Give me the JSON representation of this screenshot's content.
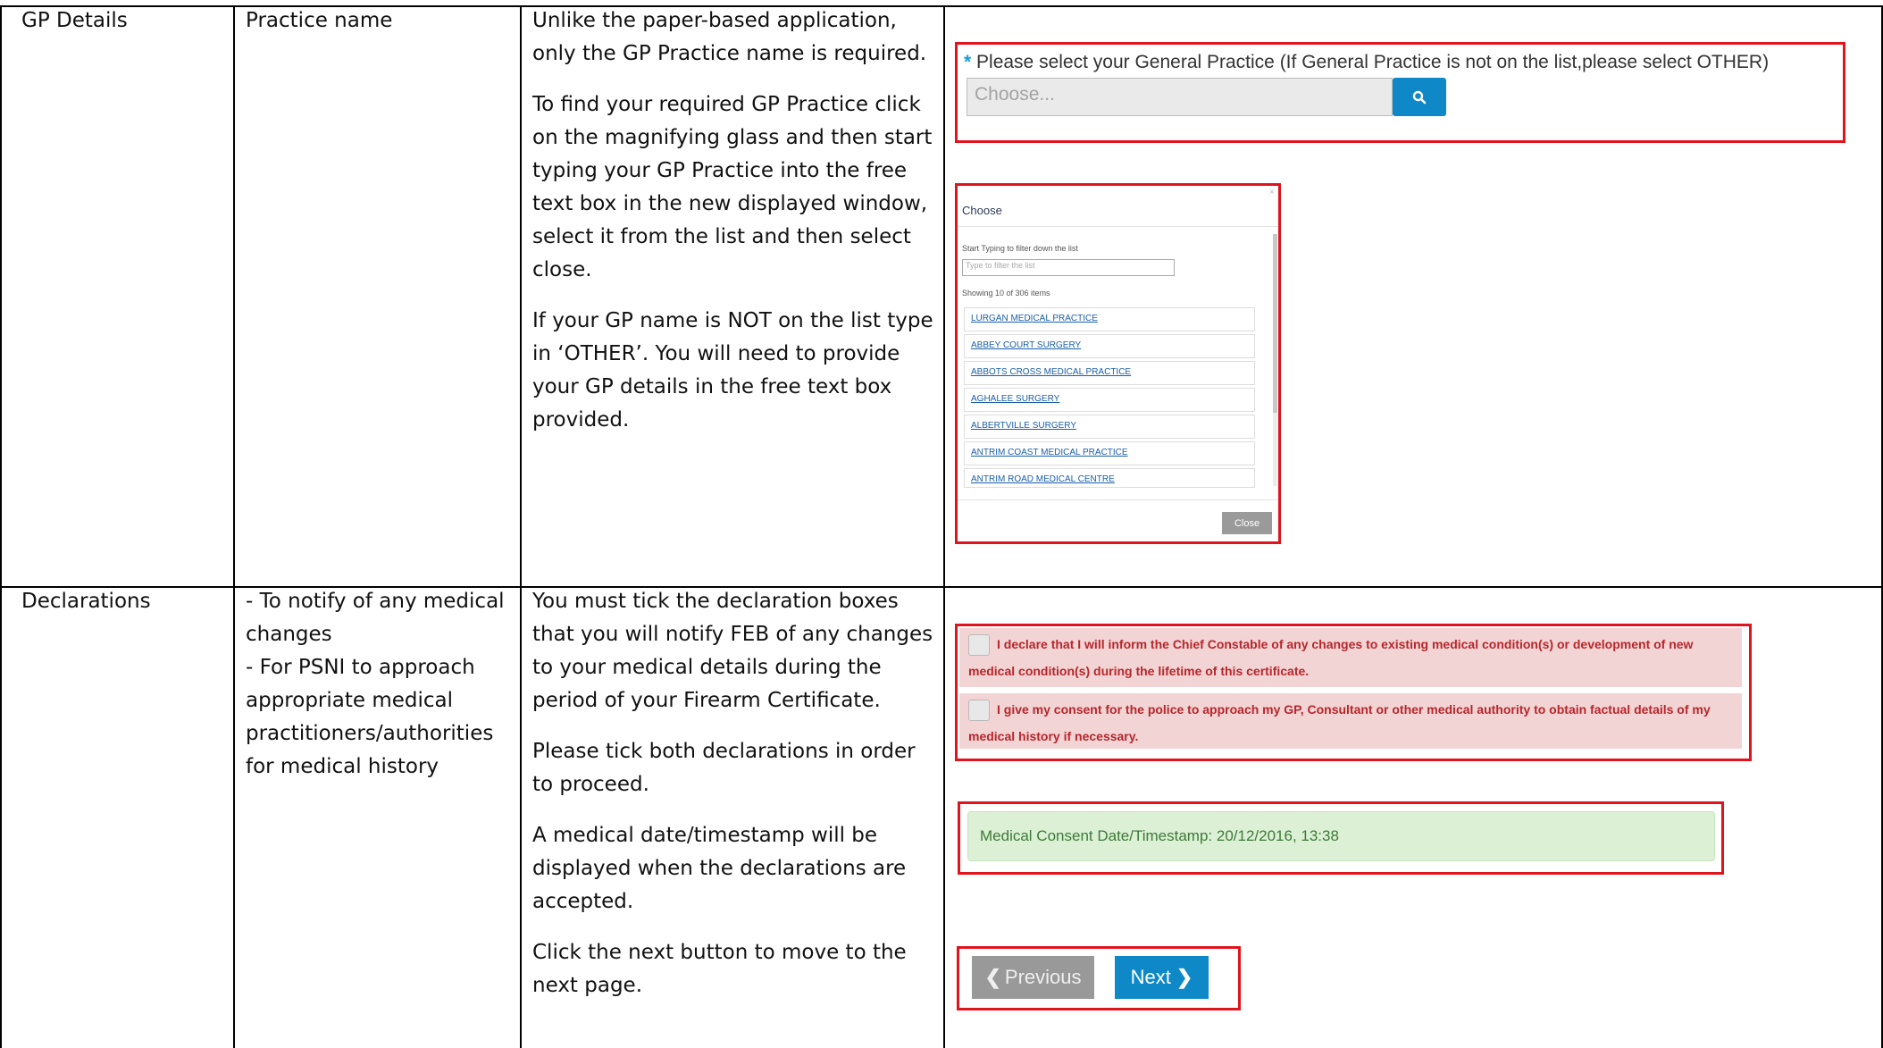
{
  "rows": [
    {
      "section": "GP Details",
      "field": "Practice name",
      "guidance": [
        "Unlike the paper-based application, only the GP Practice name is required.",
        "To find your required GP Practice click on the magnifying glass and then start typing your GP Practice into the free text box in the new displayed window, select it from the list and then select close.",
        "If your GP name is NOT on the list type in ‘OTHER’. You will need to provide your GP details in the free text box provided."
      ]
    },
    {
      "section": "Declarations",
      "field_lines": [
        "- To notify of any medical changes",
        "- For PSNI to approach appropriate medical practitioners/authorities for medical history"
      ],
      "guidance": [
        "You must tick the declaration boxes that you will notify FEB of any changes to your medical details during the period of your Firearm Certificate.",
        "Please tick both declarations in order to proceed.",
        "A medical date/timestamp will be displayed when the declarations are accepted.",
        "Click the next button to move to the next page."
      ]
    }
  ],
  "gp_select": {
    "required_marker": "*",
    "label": "Please select your General Practice (If General Practice is not on the list,please select OTHER)",
    "placeholder": "Choose...",
    "search_icon": "search-icon"
  },
  "modal": {
    "title": "Choose",
    "close_x": "×",
    "filter_label": "Start Typing to filter down the list",
    "filter_placeholder": "Type to filter the list",
    "count_text": "Showing 10 of 306 items",
    "items": [
      "LURGAN MEDICAL PRACTICE",
      "ABBEY COURT SURGERY",
      "ABBOTS CROSS MEDICAL PRACTICE",
      "AGHALEE SURGERY",
      "ALBERTVILLE SURGERY",
      "ANTRIM COAST MEDICAL PRACTICE",
      "ANTRIM ROAD MEDICAL CENTRE"
    ],
    "close_button": "Close"
  },
  "declarations": [
    "I declare that I will inform the Chief Constable of any changes to existing medical condition(s) or development of new medical condition(s) during the lifetime of this certificate.",
    "I give my consent for the police to approach my GP, Consultant or other medical authority to obtain factual details of my medical history if necessary."
  ],
  "consent_timestamp": "Medical Consent Date/Timestamp: 20/12/2016, 13:38",
  "nav": {
    "previous": "Previous",
    "next": "Next",
    "prev_icon": "chevron-left-icon",
    "next_icon": "chevron-right-icon"
  },
  "colors": {
    "highlight_border": "#e0141c",
    "primary": "#0e88c7",
    "declaration_bg": "#f2d4d5",
    "declaration_text": "#b7262b",
    "consent_bg": "#dcf0d6",
    "consent_text": "#3d7a37",
    "required_star": "#1a9bd7"
  }
}
